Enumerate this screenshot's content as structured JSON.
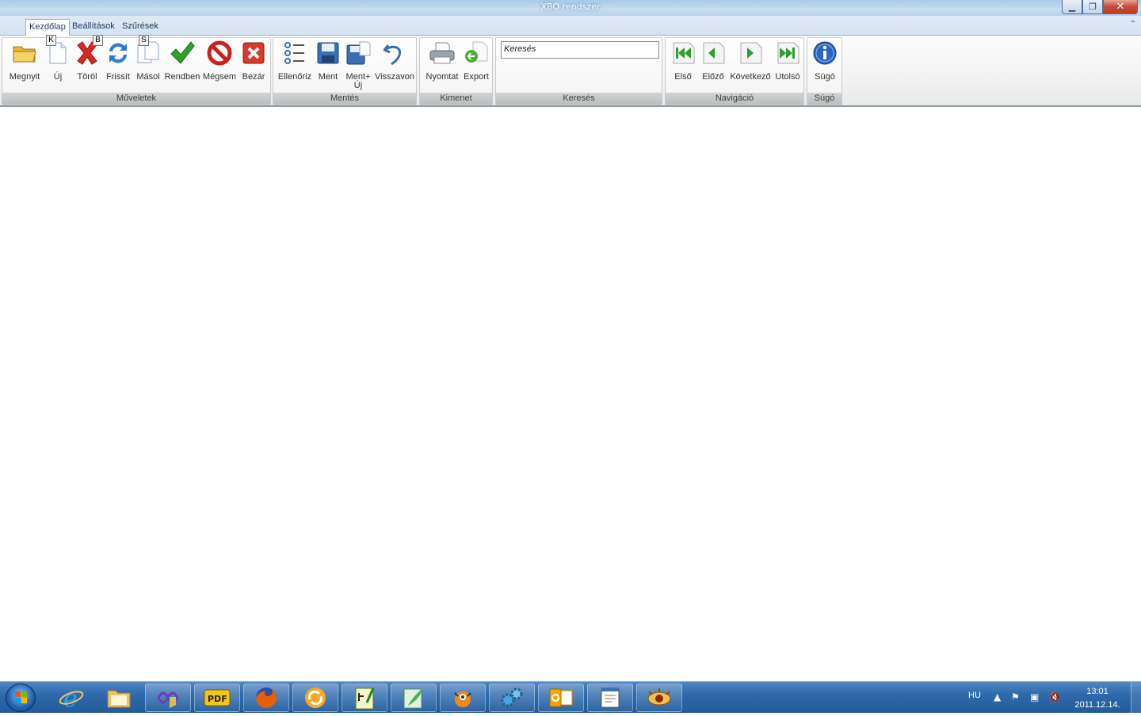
{
  "window": {
    "title": "XBO rendszer",
    "min_symbol": "▁",
    "max_symbol": "❐",
    "close_symbol": "✕"
  },
  "ribbon_tabs": [
    {
      "label": "Kezdőlap",
      "keytip": "K"
    },
    {
      "label": "Beállítások",
      "keytip": "B"
    },
    {
      "label": "Szűrések",
      "keytip": "S"
    }
  ],
  "groups": {
    "muveletek": {
      "label": "Műveletek",
      "buttons": [
        "Megnyit",
        "Új",
        "Töröl",
        "Frissít",
        "Másol",
        "Rendben",
        "Mégsem",
        "Bezár"
      ]
    },
    "mentes": {
      "label": "Mentés",
      "buttons": [
        "Ellenőriz",
        "Ment",
        "Ment+ Új",
        "Visszavon"
      ]
    },
    "kimenet": {
      "label": "Kimenet",
      "buttons": [
        "Nyomtat",
        "Export"
      ]
    },
    "kereses": {
      "label": "Keresés",
      "search_value": "Keresés"
    },
    "navigacio": {
      "label": "Navigáció",
      "buttons": [
        "Első",
        "Előző",
        "Következő",
        "Utolsó"
      ]
    },
    "sugo": {
      "label": "Súgó",
      "buttons": [
        "Súgó"
      ]
    }
  },
  "taskbar": {
    "language": "HU",
    "time": "13:01",
    "date": "2011.12.14.",
    "items": [
      "internet-explorer",
      "file-explorer",
      "visual-studio",
      "pdf-reader",
      "firefox",
      "sync-app",
      "text-editor",
      "image-editor",
      "bug-app",
      "gears-app",
      "outlook",
      "document-window",
      "xbo-app"
    ]
  },
  "colors": {
    "accent": "#2f6aad",
    "ribbon_bg": "#f1f1f1",
    "titlebar": "#b7d2ec"
  }
}
